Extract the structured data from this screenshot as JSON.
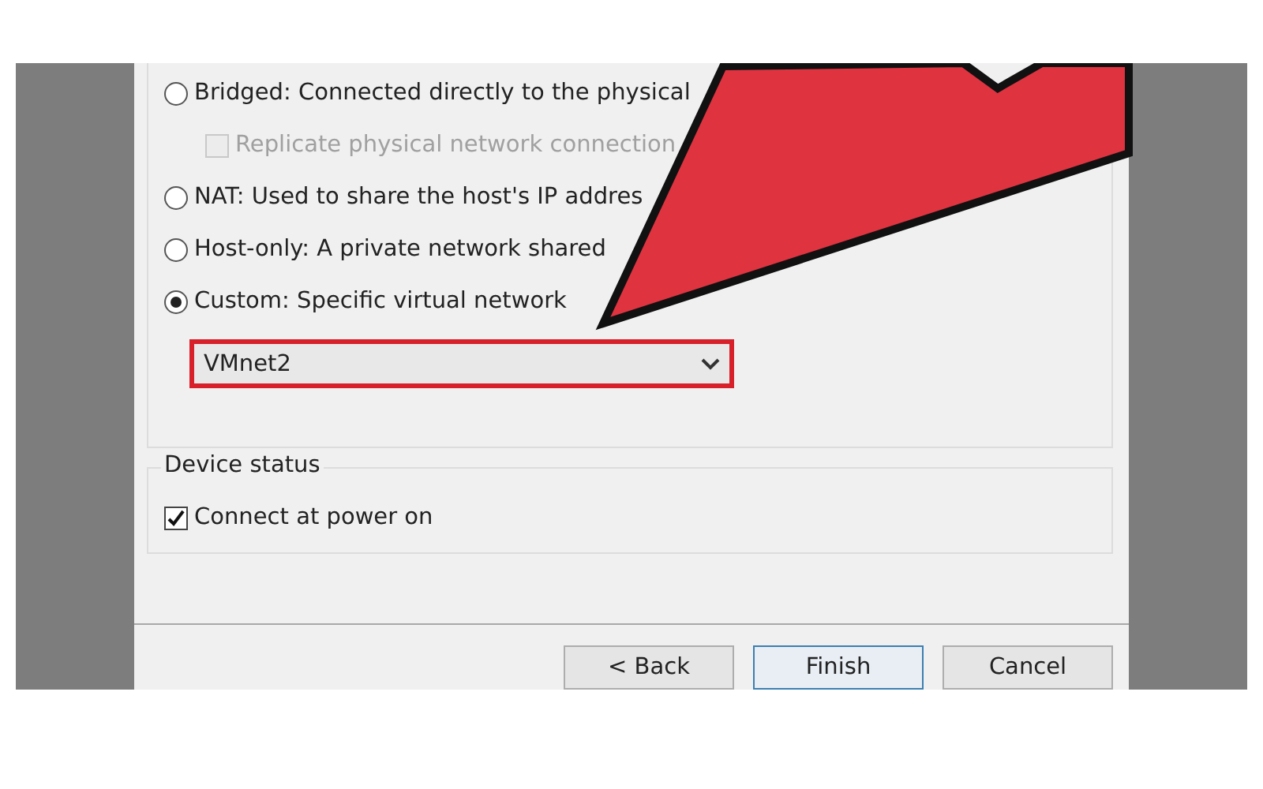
{
  "network_options": [
    {
      "kind": "radio",
      "label": "Bridged: Connected directly to the physical",
      "selected": false
    },
    {
      "kind": "checkbox",
      "label": "Replicate physical network connection",
      "checked": false,
      "disabled": true
    },
    {
      "kind": "radio",
      "label": "NAT: Used to share the host's IP addres",
      "selected": false
    },
    {
      "kind": "radio",
      "label": "Host-only: A private network shared",
      "selected": false
    },
    {
      "kind": "radio",
      "label": "Custom: Specific virtual network",
      "selected": true
    }
  ],
  "network_select": {
    "value": "VMnet2"
  },
  "device_status": {
    "title": "Device status",
    "options": [
      {
        "kind": "checkbox",
        "label": "Connect at power on",
        "checked": true,
        "disabled": false
      }
    ]
  },
  "buttons": [
    {
      "label": "< Back",
      "selected": false
    },
    {
      "label": "Finish",
      "selected": true
    },
    {
      "label": "Cancel",
      "selected": false
    }
  ]
}
